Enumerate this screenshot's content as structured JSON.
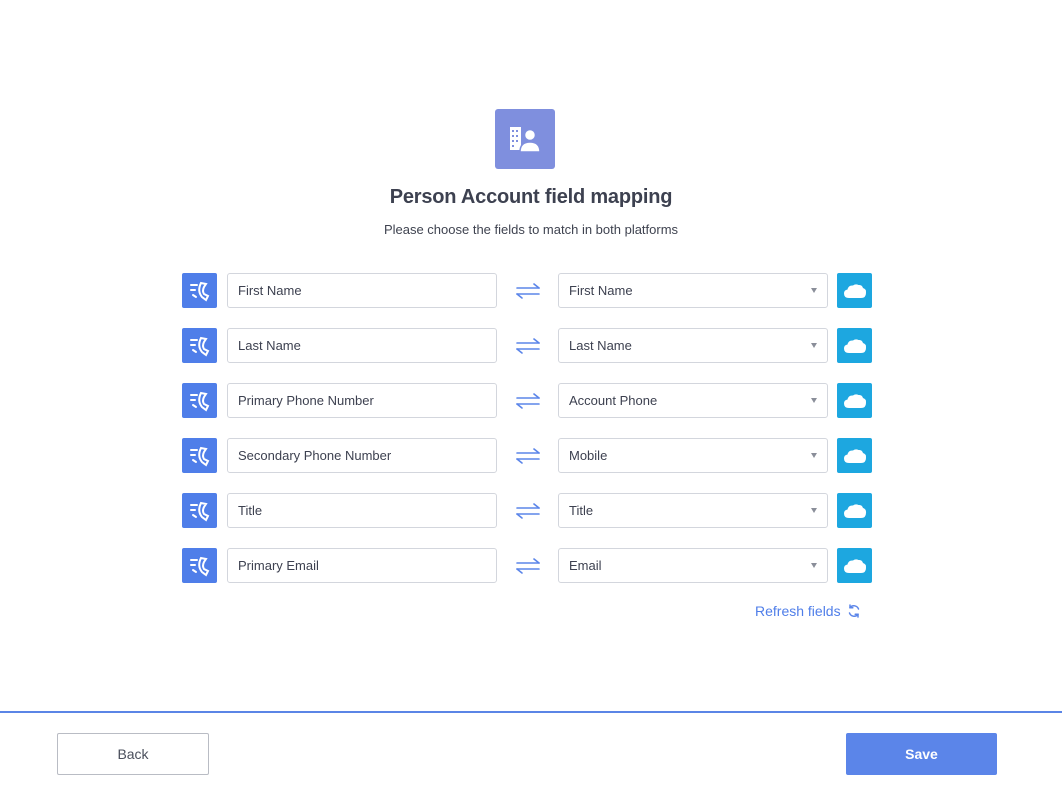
{
  "header": {
    "icon": "person-account-icon",
    "title": "Person Account field mapping",
    "subtitle": "Please choose the fields to match in both platforms"
  },
  "mappings": [
    {
      "source_field": "First Name",
      "target_field": "First Name"
    },
    {
      "source_field": "Last Name",
      "target_field": "Last Name"
    },
    {
      "source_field": "Primary Phone Number",
      "target_field": "Account Phone"
    },
    {
      "source_field": "Secondary Phone Number",
      "target_field": "Mobile"
    },
    {
      "source_field": "Title",
      "target_field": "Title"
    },
    {
      "source_field": "Primary Email",
      "target_field": "Email"
    }
  ],
  "icons": {
    "source": "dialer-app-icon",
    "target": "salesforce-cloud-icon",
    "swap": "swap-arrows-icon",
    "refresh": "refresh-icon"
  },
  "refresh_label": "Refresh fields",
  "footer": {
    "back_label": "Back",
    "save_label": "Save"
  },
  "colors": {
    "hero_icon_bg": "#7f8fde",
    "source_icon_bg": "#4f7ee9",
    "target_icon_bg": "#1da7e0",
    "accent": "#5b85e9"
  }
}
